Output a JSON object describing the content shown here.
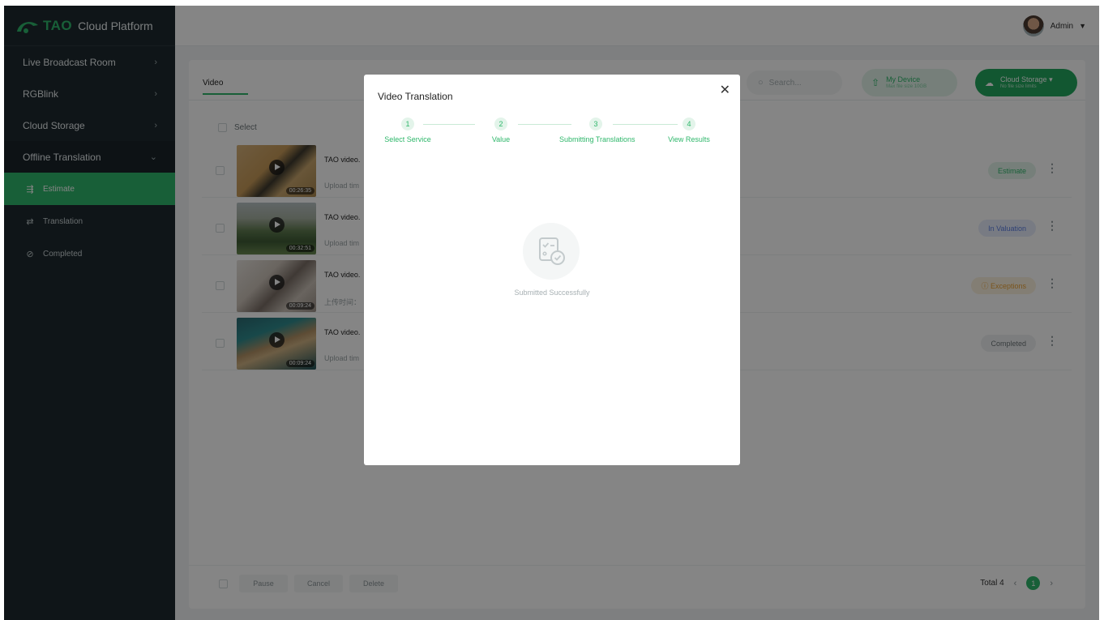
{
  "brand": {
    "logo": "TAO",
    "platform": "Cloud Platform"
  },
  "sidebar": {
    "items": [
      {
        "label": "Live Broadcast Room"
      },
      {
        "label": "RGBlink"
      },
      {
        "label": "Cloud Storage"
      },
      {
        "label": "Offline Translation"
      }
    ],
    "subitems": [
      {
        "label": "Estimate",
        "icon": "estimate-icon",
        "active": true
      },
      {
        "label": "Translation",
        "icon": "translate-icon",
        "active": false
      },
      {
        "label": "Completed",
        "icon": "check-circle-icon",
        "active": false
      }
    ]
  },
  "header": {
    "user": "Admin"
  },
  "main": {
    "tab": "Video",
    "search_placeholder": "Search...",
    "my_device": {
      "label": "My Device",
      "sub": "Max file size 10GB"
    },
    "cloud_storage": {
      "label": "Cloud Storage",
      "sub": "No file size limits"
    },
    "select_label": "Select",
    "rows": [
      {
        "title": "TAO video.",
        "meta": "Upload tim",
        "duration": "00:26:35",
        "status": "Estimate"
      },
      {
        "title": "TAO video.",
        "meta": "Upload tim",
        "duration": "00:32:51",
        "status": "In Valuation"
      },
      {
        "title": "TAO video.",
        "meta": "上传时间：",
        "duration": "00:09:24",
        "status": "Exceptions"
      },
      {
        "title": "TAO video.",
        "meta": "Upload tim",
        "duration": "00:09:24",
        "status": "Completed"
      }
    ]
  },
  "footer": {
    "pause": "Pause",
    "cancel": "Cancel",
    "delete": "Delete",
    "total": "Total 4",
    "current_page": "1"
  },
  "modal": {
    "title": "Video Translation",
    "steps": [
      {
        "num": "1",
        "label": "Select Service"
      },
      {
        "num": "2",
        "label": "Value"
      },
      {
        "num": "3",
        "label": "Submitting Translations"
      },
      {
        "num": "4",
        "label": "View Results"
      }
    ],
    "message": "Submitted Successfully"
  },
  "colors": {
    "accent": "#2fb76b",
    "sidebar_bg": "#1e2a2e",
    "overlay": "rgba(0,0,0,0.48)"
  }
}
